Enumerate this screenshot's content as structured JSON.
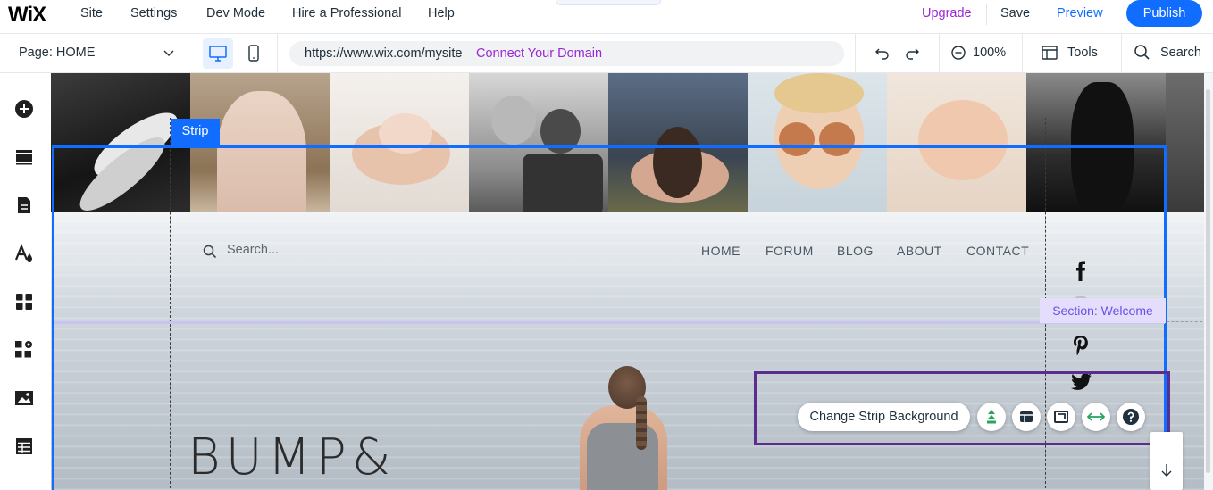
{
  "topbar": {
    "logo": "WiX",
    "menu": [
      "Site",
      "Settings",
      "Dev Mode",
      "Hire a Professional",
      "Help"
    ],
    "upgrade": "Upgrade",
    "save": "Save",
    "preview": "Preview",
    "publish": "Publish"
  },
  "toolbar": {
    "page_select": "Page: HOME",
    "url": "https://www.wix.com/mysite",
    "connect_domain": "Connect Your Domain",
    "zoom": "100%",
    "tools": "Tools",
    "search": "Search"
  },
  "sidebar": {
    "items": [
      "add-icon",
      "sections-icon",
      "pages-icon",
      "theme-icon",
      "apps-icon",
      "app-market-icon",
      "media-icon",
      "cms-icon"
    ]
  },
  "site": {
    "search_placeholder": "Search...",
    "nav": [
      "HOME",
      "FORUM",
      "BLOG",
      "ABOUT",
      "CONTACT"
    ],
    "headline": "BUMP&",
    "social": [
      "facebook-icon",
      "instagram-icon",
      "pinterest-icon",
      "twitter-icon"
    ]
  },
  "selection": {
    "strip_label": "Strip",
    "section_label": "Section: Welcome",
    "change_background": "Change Strip Background"
  },
  "colors": {
    "accent": "#116dff",
    "purple": "#9a27d5",
    "strip_border": "#116dff",
    "section_tag_bg": "#e4defc",
    "action_frame": "#5b2d8e"
  }
}
